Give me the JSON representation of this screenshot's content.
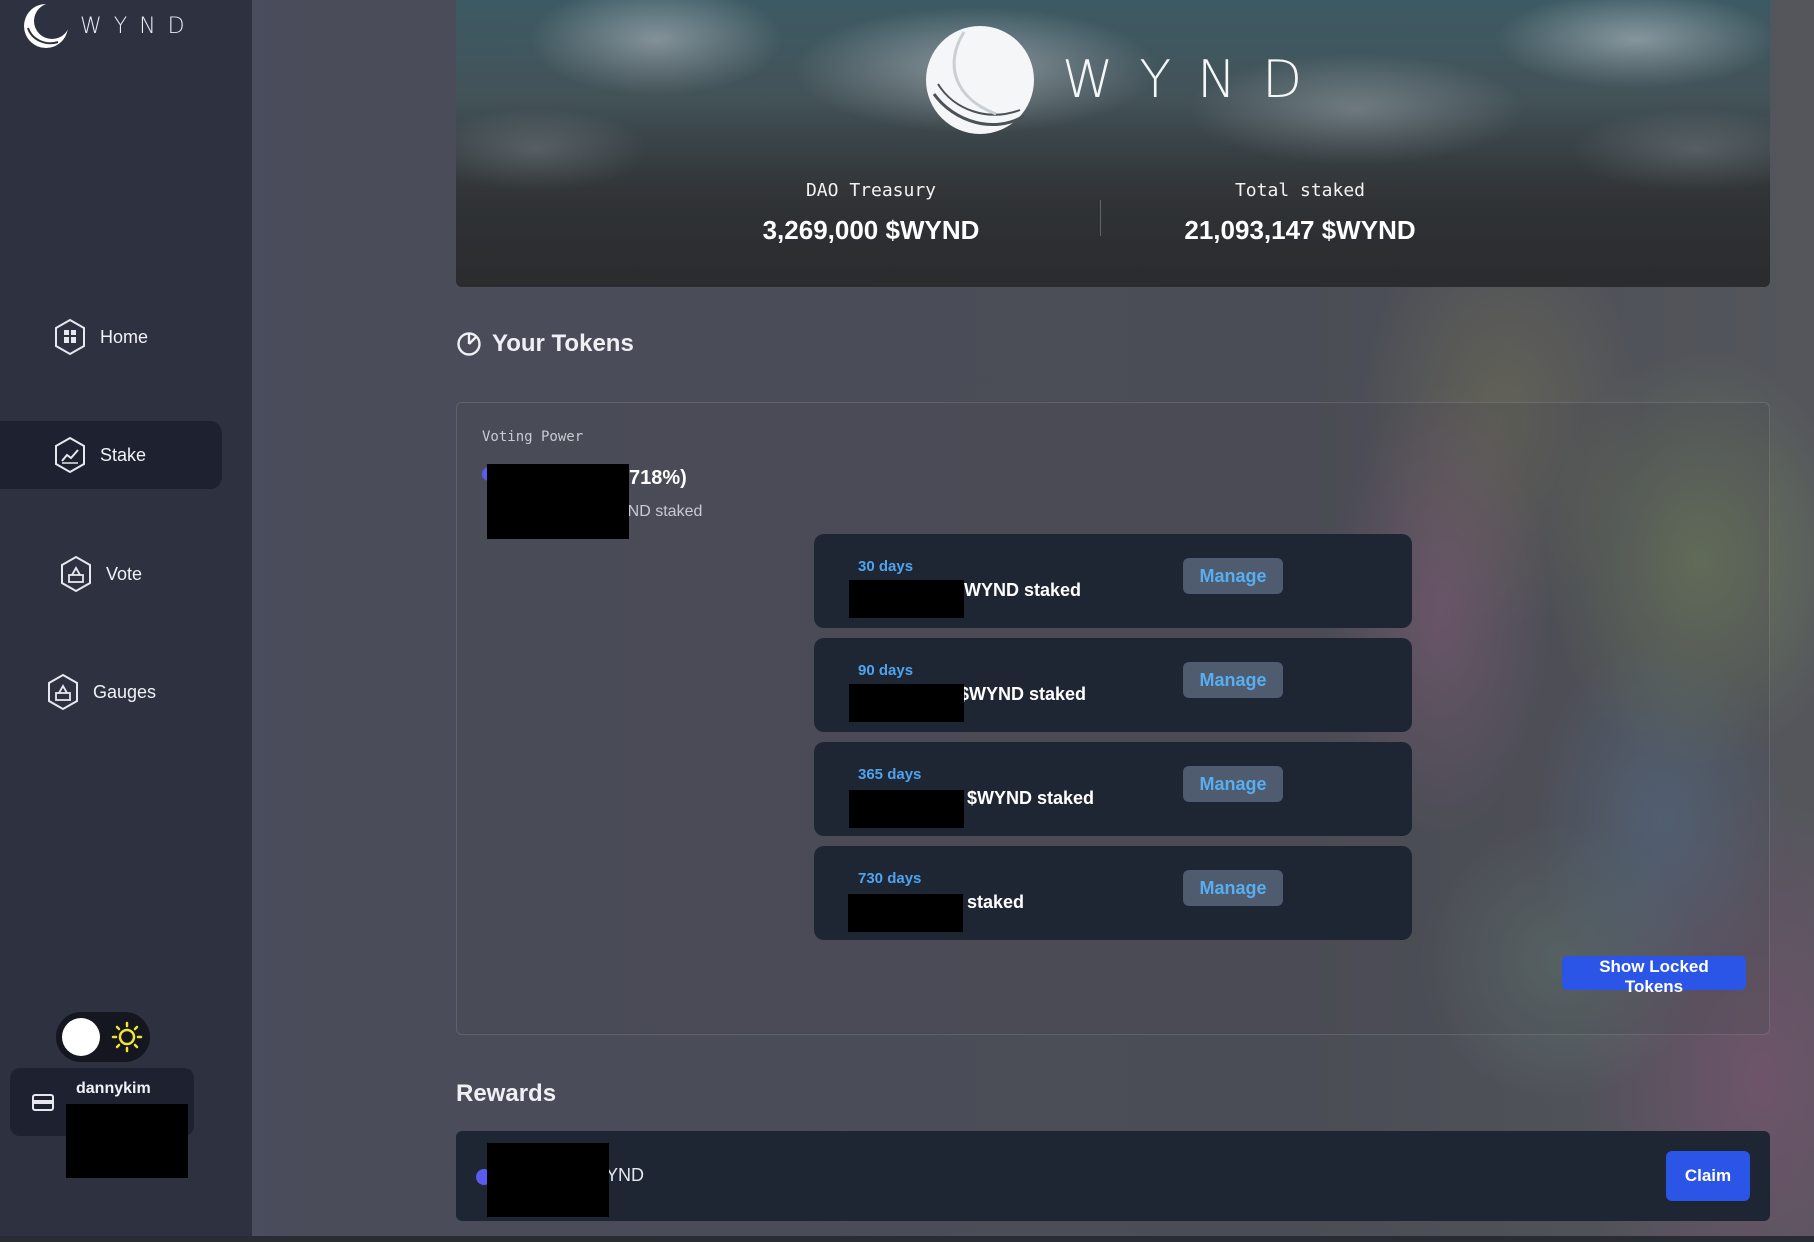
{
  "app": {
    "logo_text": "WYND"
  },
  "sidebar": {
    "items": [
      {
        "label": "Home",
        "icon": "home-icon",
        "active": false
      },
      {
        "label": "Stake",
        "icon": "chart-icon",
        "active": true
      },
      {
        "label": "Vote",
        "icon": "ballot-icon",
        "active": false
      },
      {
        "label": "Gauges",
        "icon": "ballot-icon",
        "active": false
      }
    ],
    "theme_toggle": {
      "icon": "sun-icon",
      "mode": "light"
    },
    "wallet": {
      "name": "dannykim",
      "icon": "wallet-icon"
    }
  },
  "hero": {
    "logo_text": "WYND",
    "treasury": {
      "label": "DAO Treasury",
      "value": "3,269,000 $WYND"
    },
    "total_staked": {
      "label": "Total staked",
      "value": "21,093,147 $WYND"
    }
  },
  "tokens": {
    "title": "Your Tokens",
    "title_icon": "pie-icon",
    "voting_power_label": "Voting Power",
    "voting_power_value": "718%)",
    "voting_power_sub": "YND staked",
    "stakes": [
      {
        "days": "30 days",
        "amount": "WYND staked",
        "manage": "Manage"
      },
      {
        "days": "90 days",
        "amount": "$WYND staked",
        "manage": "Manage"
      },
      {
        "days": "365 days",
        "amount": "$WYND staked",
        "manage": "Manage"
      },
      {
        "days": "730 days",
        "amount": "staked",
        "manage": "Manage"
      }
    ],
    "show_locked_label": "Show Locked Tokens"
  },
  "rewards": {
    "title": "Rewards",
    "value": "YND",
    "claim_label": "Claim"
  },
  "colors": {
    "accent": "#2b55e6",
    "link": "#4ea4ee",
    "card": "#1e2533",
    "sidebar": "#2e3140"
  }
}
